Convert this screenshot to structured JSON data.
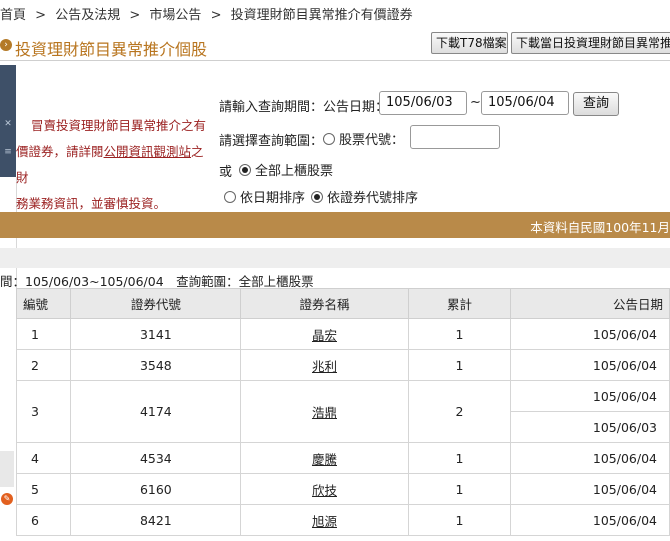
{
  "breadcrumb": [
    "首頁",
    "公告及法規",
    "市場公告",
    "投資理財節目異常推介有價證券"
  ],
  "breadcrumb_sep": ">",
  "page_title": "投資理財節目異常推介個股",
  "buttons": {
    "download_t78": "下載T78檔案",
    "download_today": "下載當日投資理財節目異常推介"
  },
  "notice": {
    "line1": "冒賣投資理財節目異常推介之有",
    "line2_pre": "價證券，請詳閱",
    "line2_link": "公開資訊觀測站",
    "line2_post": "之財",
    "line3": "務業務資訊，並審慎投資。"
  },
  "form": {
    "period_label": "請輸入查詢期間：公告日期：",
    "date_from": "105/06/03",
    "date_sep": "~",
    "date_to": "105/06/04",
    "query_button": "查詢",
    "scope_label": "請選擇查詢範圍：",
    "stock_code_label": "股票代號：",
    "stock_code_value": "",
    "or_label": "或",
    "all_label": "全部上櫃股票",
    "sort_by_date": "依日期排序",
    "sort_by_code": "依證券代號排序"
  },
  "gold_bar_text": "本資料自民國100年11月",
  "query_info": "間：105/06/03~105/06/04　查詢範圍：全部上櫃股票",
  "table": {
    "headers": [
      "編號",
      "證券代號",
      "證券名稱",
      "累計",
      "公告日期"
    ],
    "rows": [
      {
        "no": "1",
        "code": "3141",
        "name": "晶宏",
        "count": "1",
        "dates": [
          "105/06/04"
        ]
      },
      {
        "no": "2",
        "code": "3548",
        "name": "兆利",
        "count": "1",
        "dates": [
          "105/06/04"
        ]
      },
      {
        "no": "3",
        "code": "4174",
        "name": "浩鼎",
        "count": "2",
        "dates": [
          "105/06/04",
          "105/06/03"
        ]
      },
      {
        "no": "4",
        "code": "4534",
        "name": "慶騰",
        "count": "1",
        "dates": [
          "105/06/04"
        ]
      },
      {
        "no": "5",
        "code": "6160",
        "name": "欣技",
        "count": "1",
        "dates": [
          "105/06/04"
        ]
      },
      {
        "no": "6",
        "code": "8421",
        "name": "旭源",
        "count": "1",
        "dates": [
          "105/06/04"
        ]
      }
    ]
  },
  "colors": {
    "accent": "#b8751f",
    "gold_bar": "#b98a49",
    "notice": "#9a1f1f",
    "left_strip": "#3e5068"
  }
}
